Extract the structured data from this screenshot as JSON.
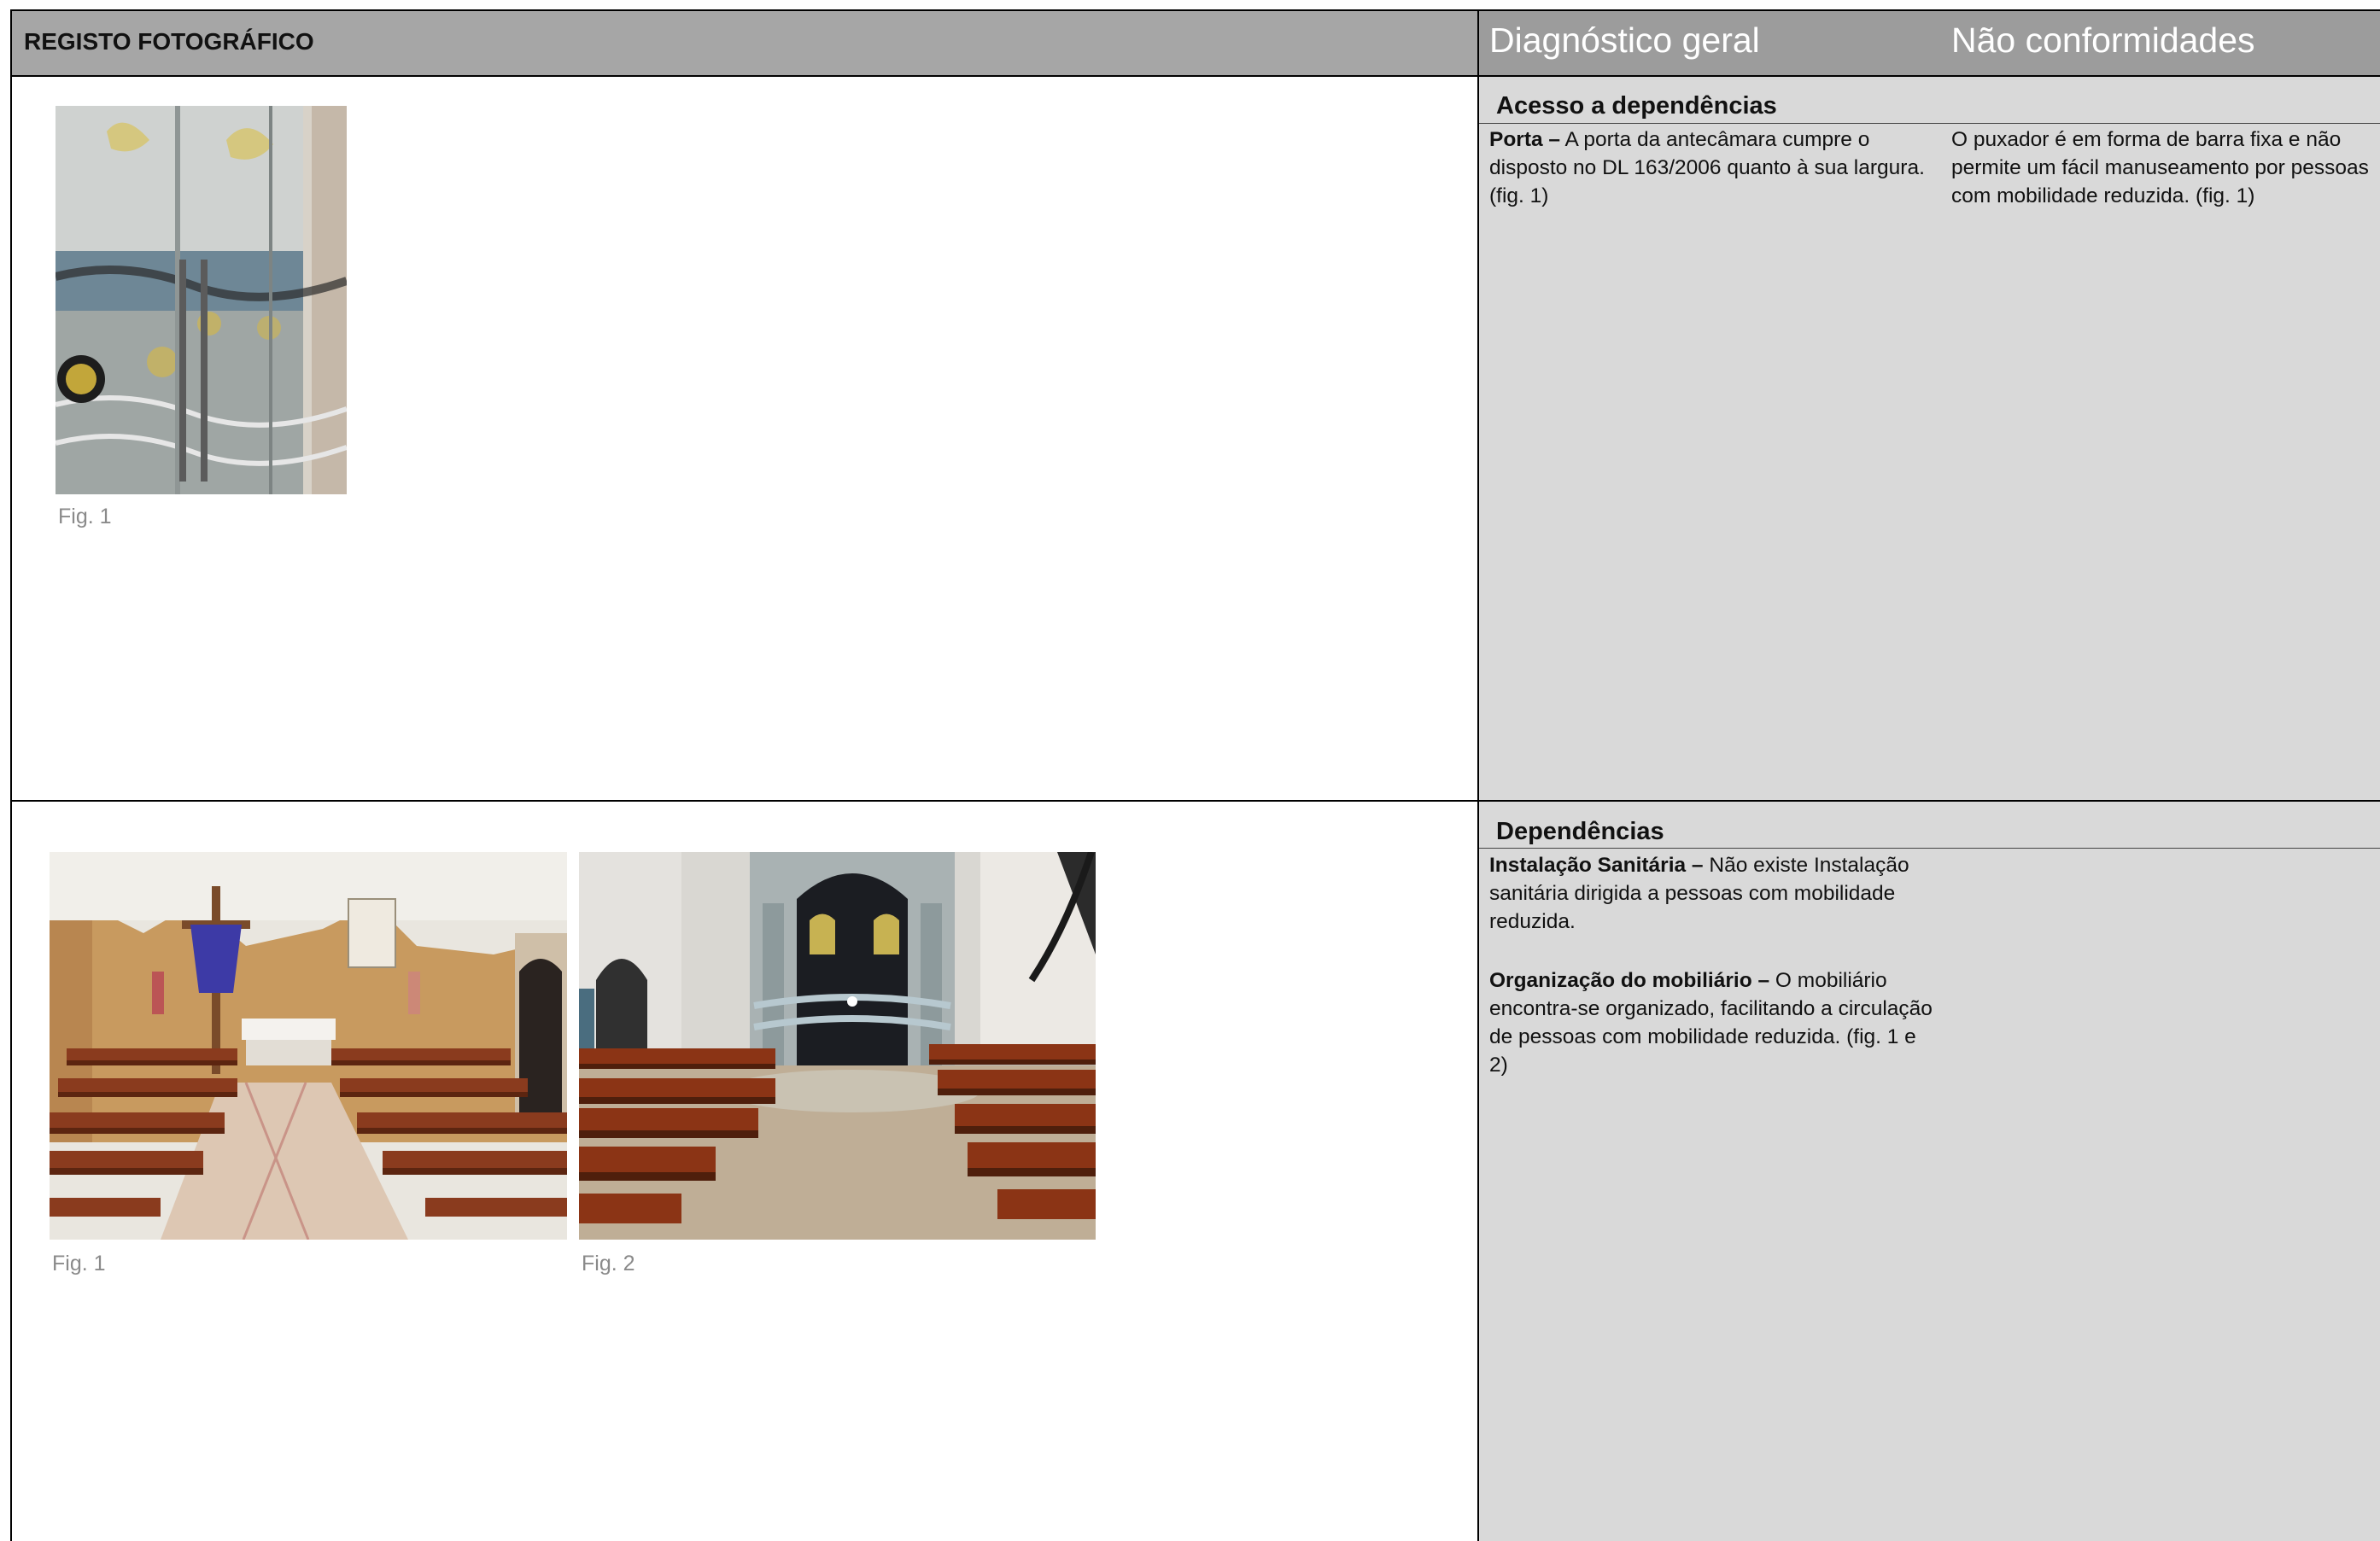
{
  "header": {
    "left_title": "REGISTO FOTOGRÁFICO",
    "col_diagnostico": "Diagnóstico geral",
    "col_nao_conformidades": "Não conformidades"
  },
  "section1": {
    "title": "Acesso a dependências",
    "figures": [
      {
        "caption": "Fig. 1"
      }
    ],
    "diagnostico": [
      {
        "lead": "Porta –",
        "text": " A porta da antecâmara cumpre o disposto no DL 163/2006 quanto à sua largura. (fig. 1)"
      }
    ],
    "nao_conformidades": "O puxador é em forma de barra fixa e não permite um fácil manuseamento por pessoas com mobilidade reduzida. (fig. 1)"
  },
  "section2": {
    "title": "Dependências",
    "figures": [
      {
        "caption": "Fig. 1"
      },
      {
        "caption": "Fig. 2"
      }
    ],
    "diagnostico": [
      {
        "lead": "Instalação Sanitária –",
        "text": " Não existe Instalação sanitária dirigida a pessoas com mobilidade reduzida."
      },
      {
        "lead": "Organização do mobiliário –",
        "text": " O mobiliário encontra-se organizado, facilitando a circulação de pessoas com mobilidade reduzida. (fig. 1 e 2)"
      }
    ]
  }
}
